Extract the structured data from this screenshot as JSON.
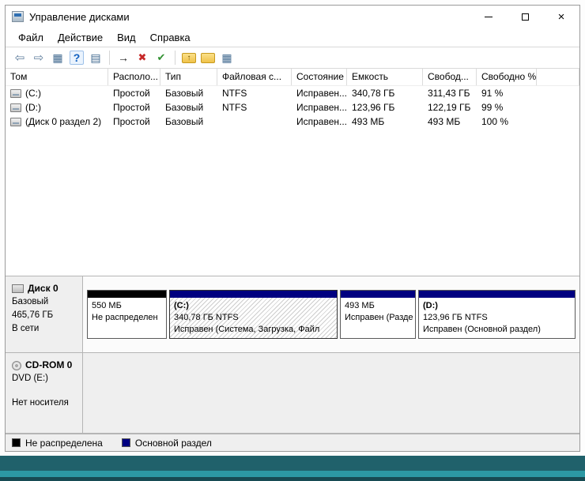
{
  "window": {
    "title": "Управление дисками"
  },
  "icons": {
    "close_glyph": "×"
  },
  "menu": {
    "items": [
      "Файл",
      "Действие",
      "Вид",
      "Справка"
    ]
  },
  "toolbar": {
    "icons": [
      {
        "name": "back-icon",
        "glyph": "⇦"
      },
      {
        "name": "forward-icon",
        "glyph": "⇨"
      },
      {
        "name": "console-tree-icon",
        "glyph": "▦"
      },
      {
        "name": "help-icon",
        "glyph": "?"
      },
      {
        "name": "action-pane-icon",
        "glyph": "▤"
      },
      {
        "name": "action-arrow-icon",
        "glyph": "→"
      },
      {
        "name": "delete-volume-icon",
        "glyph": "✖"
      },
      {
        "name": "check-volume-icon",
        "glyph": "✔"
      },
      {
        "name": "folder-up-icon",
        "glyph": "↑"
      },
      {
        "name": "folder-icon",
        "glyph": ""
      },
      {
        "name": "details-view-icon",
        "glyph": "▦"
      }
    ]
  },
  "table": {
    "columns": [
      "Том",
      "Располо...",
      "Тип",
      "Файловая с...",
      "Состояние",
      "Емкость",
      "Свобод...",
      "Свободно %"
    ],
    "rows": [
      {
        "volume": "(C:)",
        "layout": "Простой",
        "type": "Базовый",
        "fs": "NTFS",
        "status": "Исправен...",
        "capacity": "340,78 ГБ",
        "free": "311,43 ГБ",
        "free_pct": "91 %"
      },
      {
        "volume": "(D:)",
        "layout": "Простой",
        "type": "Базовый",
        "fs": "NTFS",
        "status": "Исправен...",
        "capacity": "123,96 ГБ",
        "free": "122,19 ГБ",
        "free_pct": "99 %"
      },
      {
        "volume": "(Диск 0 раздел 2)",
        "layout": "Простой",
        "type": "Базовый",
        "fs": "",
        "status": "Исправен...",
        "capacity": "493 МБ",
        "free": "493 МБ",
        "free_pct": "100 %"
      }
    ]
  },
  "disks": {
    "disk0": {
      "name": "Диск 0",
      "type": "Базовый",
      "size": "465,76 ГБ",
      "status": "В сети",
      "partitions": [
        {
          "size": "550 МБ",
          "status": "Не распределен"
        },
        {
          "name": "(C:)",
          "size": "340,78 ГБ NTFS",
          "status": "Исправен (Система, Загрузка, Файл"
        },
        {
          "size": "493 МБ",
          "status": "Исправен (Разде"
        },
        {
          "name": "(D:)",
          "size": "123,96 ГБ NTFS",
          "status": "Исправен (Основной раздел)"
        }
      ]
    },
    "cdrom": {
      "name": "CD-ROM 0",
      "media": "DVD (E:)",
      "status": "Нет носителя"
    }
  },
  "legend": {
    "items": [
      {
        "label": "Не распределена",
        "color": "#000000"
      },
      {
        "label": "Основной раздел",
        "color": "#000080"
      }
    ]
  },
  "colors": {
    "primary_partition": "#000080",
    "unallocated": "#000000",
    "desktop_teal": "#20616b"
  }
}
